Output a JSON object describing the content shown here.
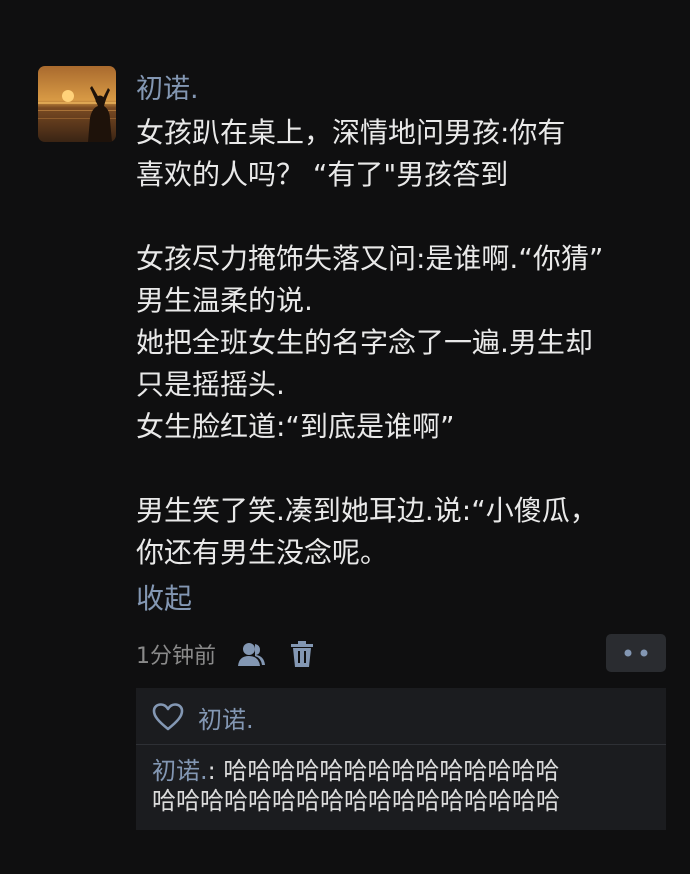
{
  "post": {
    "username": "初诺.",
    "lines": [
      "女孩趴在桌上，深情地问男孩:你有",
      "喜欢的人吗？ “有了\"男孩答到",
      "",
      "女孩尽力掩饰失落又问:是谁啊.“你猜”",
      "男生温柔的说.",
      "她把全班女生的名字念了一遍.男生却",
      "只是摇摇头.",
      "女生脸红道:“到底是谁啊”",
      "",
      "男生笑了笑.凑到她耳边.说:“小傻瓜，",
      "你还有男生没念呢。"
    ],
    "collapse_label": "收起",
    "time": "1分钟前",
    "icons": {
      "avatar": "sunset-silhouette-avatar",
      "visibility": "friends-icon",
      "delete": "trash-icon",
      "more": "more-dots-icon",
      "like": "heart-icon"
    }
  },
  "likes": {
    "liker": "初诺."
  },
  "comment": {
    "author": "初诺.",
    "separator": ": ",
    "line1": "哈哈哈哈哈哈哈哈哈哈哈哈哈哈",
    "line2": "哈哈哈哈哈哈哈哈哈哈哈哈哈哈哈哈哈"
  },
  "colors": {
    "background": "#0f0f10",
    "link": "#8397b3",
    "text": "#e9e9e9",
    "comment_bg": "#1b1c1f",
    "button_bg": "#2a2c30"
  }
}
